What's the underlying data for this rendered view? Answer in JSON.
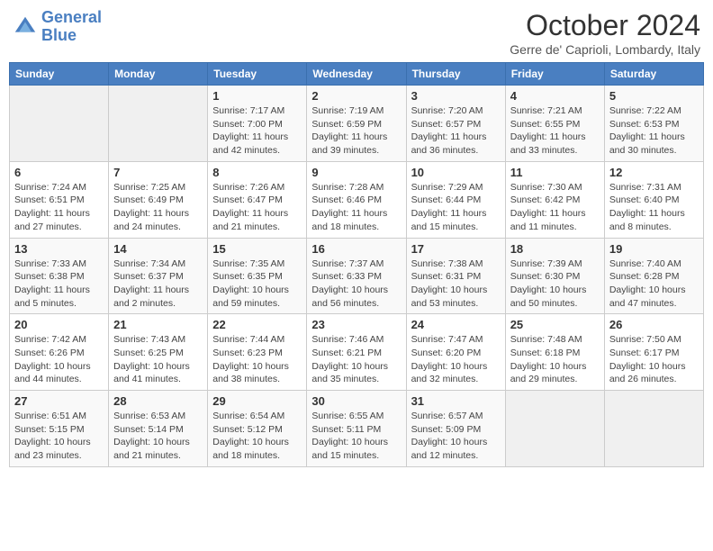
{
  "header": {
    "logo_line1": "General",
    "logo_line2": "Blue",
    "month": "October 2024",
    "location": "Gerre de' Caprioli, Lombardy, Italy"
  },
  "days_of_week": [
    "Sunday",
    "Monday",
    "Tuesday",
    "Wednesday",
    "Thursday",
    "Friday",
    "Saturday"
  ],
  "weeks": [
    [
      {
        "day": "",
        "sunrise": "",
        "sunset": "",
        "daylight": ""
      },
      {
        "day": "",
        "sunrise": "",
        "sunset": "",
        "daylight": ""
      },
      {
        "day": "1",
        "sunrise": "Sunrise: 7:17 AM",
        "sunset": "Sunset: 7:00 PM",
        "daylight": "Daylight: 11 hours and 42 minutes."
      },
      {
        "day": "2",
        "sunrise": "Sunrise: 7:19 AM",
        "sunset": "Sunset: 6:59 PM",
        "daylight": "Daylight: 11 hours and 39 minutes."
      },
      {
        "day": "3",
        "sunrise": "Sunrise: 7:20 AM",
        "sunset": "Sunset: 6:57 PM",
        "daylight": "Daylight: 11 hours and 36 minutes."
      },
      {
        "day": "4",
        "sunrise": "Sunrise: 7:21 AM",
        "sunset": "Sunset: 6:55 PM",
        "daylight": "Daylight: 11 hours and 33 minutes."
      },
      {
        "day": "5",
        "sunrise": "Sunrise: 7:22 AM",
        "sunset": "Sunset: 6:53 PM",
        "daylight": "Daylight: 11 hours and 30 minutes."
      }
    ],
    [
      {
        "day": "6",
        "sunrise": "Sunrise: 7:24 AM",
        "sunset": "Sunset: 6:51 PM",
        "daylight": "Daylight: 11 hours and 27 minutes."
      },
      {
        "day": "7",
        "sunrise": "Sunrise: 7:25 AM",
        "sunset": "Sunset: 6:49 PM",
        "daylight": "Daylight: 11 hours and 24 minutes."
      },
      {
        "day": "8",
        "sunrise": "Sunrise: 7:26 AM",
        "sunset": "Sunset: 6:47 PM",
        "daylight": "Daylight: 11 hours and 21 minutes."
      },
      {
        "day": "9",
        "sunrise": "Sunrise: 7:28 AM",
        "sunset": "Sunset: 6:46 PM",
        "daylight": "Daylight: 11 hours and 18 minutes."
      },
      {
        "day": "10",
        "sunrise": "Sunrise: 7:29 AM",
        "sunset": "Sunset: 6:44 PM",
        "daylight": "Daylight: 11 hours and 15 minutes."
      },
      {
        "day": "11",
        "sunrise": "Sunrise: 7:30 AM",
        "sunset": "Sunset: 6:42 PM",
        "daylight": "Daylight: 11 hours and 11 minutes."
      },
      {
        "day": "12",
        "sunrise": "Sunrise: 7:31 AM",
        "sunset": "Sunset: 6:40 PM",
        "daylight": "Daylight: 11 hours and 8 minutes."
      }
    ],
    [
      {
        "day": "13",
        "sunrise": "Sunrise: 7:33 AM",
        "sunset": "Sunset: 6:38 PM",
        "daylight": "Daylight: 11 hours and 5 minutes."
      },
      {
        "day": "14",
        "sunrise": "Sunrise: 7:34 AM",
        "sunset": "Sunset: 6:37 PM",
        "daylight": "Daylight: 11 hours and 2 minutes."
      },
      {
        "day": "15",
        "sunrise": "Sunrise: 7:35 AM",
        "sunset": "Sunset: 6:35 PM",
        "daylight": "Daylight: 10 hours and 59 minutes."
      },
      {
        "day": "16",
        "sunrise": "Sunrise: 7:37 AM",
        "sunset": "Sunset: 6:33 PM",
        "daylight": "Daylight: 10 hours and 56 minutes."
      },
      {
        "day": "17",
        "sunrise": "Sunrise: 7:38 AM",
        "sunset": "Sunset: 6:31 PM",
        "daylight": "Daylight: 10 hours and 53 minutes."
      },
      {
        "day": "18",
        "sunrise": "Sunrise: 7:39 AM",
        "sunset": "Sunset: 6:30 PM",
        "daylight": "Daylight: 10 hours and 50 minutes."
      },
      {
        "day": "19",
        "sunrise": "Sunrise: 7:40 AM",
        "sunset": "Sunset: 6:28 PM",
        "daylight": "Daylight: 10 hours and 47 minutes."
      }
    ],
    [
      {
        "day": "20",
        "sunrise": "Sunrise: 7:42 AM",
        "sunset": "Sunset: 6:26 PM",
        "daylight": "Daylight: 10 hours and 44 minutes."
      },
      {
        "day": "21",
        "sunrise": "Sunrise: 7:43 AM",
        "sunset": "Sunset: 6:25 PM",
        "daylight": "Daylight: 10 hours and 41 minutes."
      },
      {
        "day": "22",
        "sunrise": "Sunrise: 7:44 AM",
        "sunset": "Sunset: 6:23 PM",
        "daylight": "Daylight: 10 hours and 38 minutes."
      },
      {
        "day": "23",
        "sunrise": "Sunrise: 7:46 AM",
        "sunset": "Sunset: 6:21 PM",
        "daylight": "Daylight: 10 hours and 35 minutes."
      },
      {
        "day": "24",
        "sunrise": "Sunrise: 7:47 AM",
        "sunset": "Sunset: 6:20 PM",
        "daylight": "Daylight: 10 hours and 32 minutes."
      },
      {
        "day": "25",
        "sunrise": "Sunrise: 7:48 AM",
        "sunset": "Sunset: 6:18 PM",
        "daylight": "Daylight: 10 hours and 29 minutes."
      },
      {
        "day": "26",
        "sunrise": "Sunrise: 7:50 AM",
        "sunset": "Sunset: 6:17 PM",
        "daylight": "Daylight: 10 hours and 26 minutes."
      }
    ],
    [
      {
        "day": "27",
        "sunrise": "Sunrise: 6:51 AM",
        "sunset": "Sunset: 5:15 PM",
        "daylight": "Daylight: 10 hours and 23 minutes."
      },
      {
        "day": "28",
        "sunrise": "Sunrise: 6:53 AM",
        "sunset": "Sunset: 5:14 PM",
        "daylight": "Daylight: 10 hours and 21 minutes."
      },
      {
        "day": "29",
        "sunrise": "Sunrise: 6:54 AM",
        "sunset": "Sunset: 5:12 PM",
        "daylight": "Daylight: 10 hours and 18 minutes."
      },
      {
        "day": "30",
        "sunrise": "Sunrise: 6:55 AM",
        "sunset": "Sunset: 5:11 PM",
        "daylight": "Daylight: 10 hours and 15 minutes."
      },
      {
        "day": "31",
        "sunrise": "Sunrise: 6:57 AM",
        "sunset": "Sunset: 5:09 PM",
        "daylight": "Daylight: 10 hours and 12 minutes."
      },
      {
        "day": "",
        "sunrise": "",
        "sunset": "",
        "daylight": ""
      },
      {
        "day": "",
        "sunrise": "",
        "sunset": "",
        "daylight": ""
      }
    ]
  ]
}
